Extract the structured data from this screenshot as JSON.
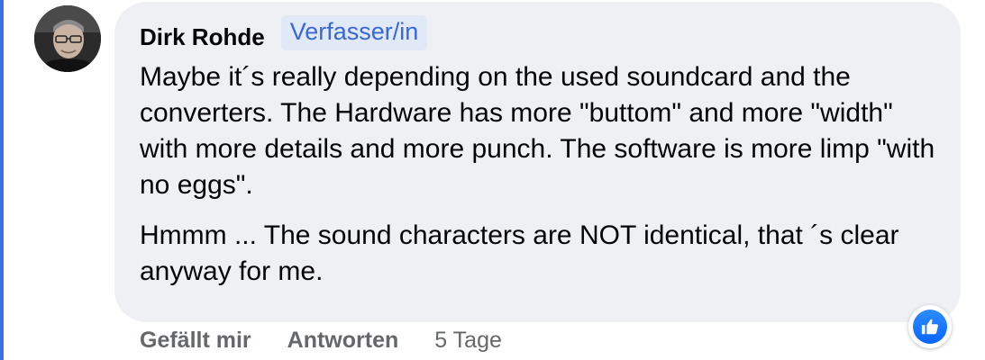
{
  "comment": {
    "author": "Dirk Rohde",
    "author_badge": "Verfasser/in",
    "paragraphs": [
      "Maybe it´s really depending on the used soundcard and the converters. The Hardware has more \"buttom\" and more \"width\" with more details and more punch. The software is more limp \"with no eggs\".",
      "Hmmm ... The sound characters are NOT identical, that ´s clear anyway for me."
    ],
    "reaction_icon": "thumbs-up-icon"
  },
  "actions": {
    "like_label": "Gefällt mir",
    "reply_label": "Antworten",
    "timestamp": "5 Tage"
  },
  "colors": {
    "thread_line": "#3b6fe0",
    "bubble": "#eef0f3",
    "badge_bg": "#e1e8f6",
    "badge_text": "#3867d6",
    "like_blue": "#0866ff",
    "action_gray": "#65676b"
  }
}
